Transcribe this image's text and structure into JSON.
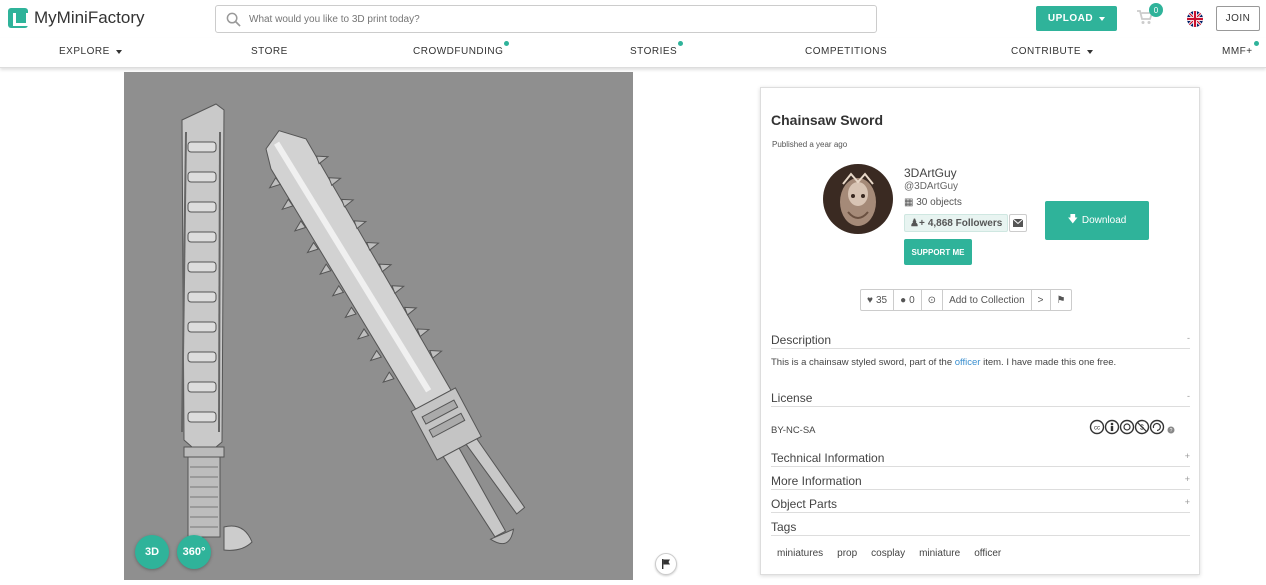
{
  "header": {
    "logo_text": "MyMiniFactory",
    "search_placeholder": "What would you like to 3D print today?",
    "upload_label": "UPLOAD",
    "cart_count": "0",
    "join_label": "JOIN",
    "accent_color": "#2fb39a"
  },
  "nav": {
    "items": [
      {
        "label": "EXPLORE",
        "has_caret": true,
        "has_dot": false
      },
      {
        "label": "STORE",
        "has_caret": false,
        "has_dot": false
      },
      {
        "label": "CROWDFUNDING",
        "has_caret": false,
        "has_dot": true
      },
      {
        "label": "STORIES",
        "has_caret": false,
        "has_dot": true
      },
      {
        "label": "COMPETITIONS",
        "has_caret": false,
        "has_dot": false
      },
      {
        "label": "CONTRIBUTE",
        "has_caret": true,
        "has_dot": false
      },
      {
        "label": "MMF+",
        "has_caret": false,
        "has_dot": true
      }
    ]
  },
  "viewer": {
    "btn_3d": "3D",
    "btn_360": "360°"
  },
  "object": {
    "title": "Chainsaw Sword",
    "published": "Published a year ago",
    "author_name": "3DArtGuy",
    "author_handle": "@3DArtGuy",
    "objects_count": "30 objects",
    "followers": "4,868 Followers",
    "support_label": "SUPPORT ME",
    "download_label": "Download",
    "likes": "35",
    "comments": "0",
    "add_to_collection": "Add to Collection"
  },
  "sections": {
    "description_label": "Description",
    "description_toggle": "-",
    "description_pre": "This is a chainsaw styled sword, part of the ",
    "description_link": "officer",
    "description_post": " item. I have made this one free.",
    "license_label": "License",
    "license_toggle": "-",
    "license_code": "BY-NC-SA",
    "technical_label": "Technical Information",
    "more_label": "More Information",
    "parts_label": "Object Parts",
    "expand_toggle": "+",
    "tags_label": "Tags"
  },
  "tags": [
    "miniatures",
    "prop",
    "cosplay",
    "miniature",
    "officer"
  ]
}
